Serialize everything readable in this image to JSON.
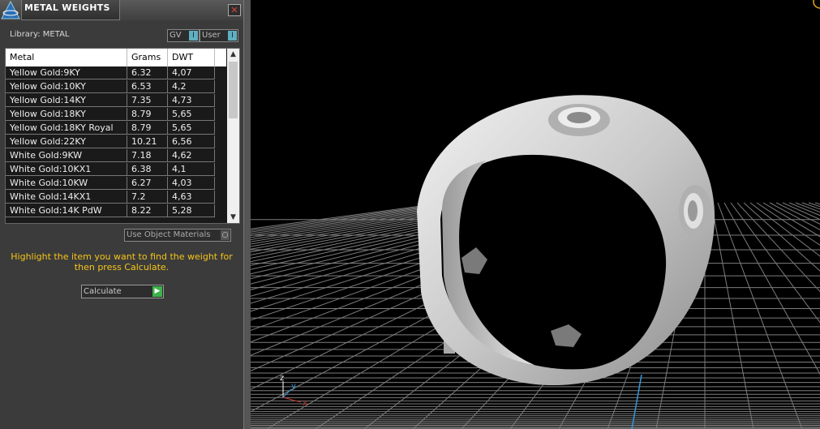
{
  "panel": {
    "title": "METAL WEIGHTS",
    "close_glyph": "✕",
    "library_label": "Library: METAL",
    "gv_label": "GV",
    "user_label": "User",
    "toggle_glyph": "I",
    "columns": [
      "Metal",
      "Grams",
      "DWT"
    ],
    "rows": [
      {
        "metal": "Yellow Gold:9KY",
        "grams": "6.32",
        "dwt": "4,07"
      },
      {
        "metal": "Yellow Gold:10KY",
        "grams": "6.53",
        "dwt": "4,2"
      },
      {
        "metal": "Yellow Gold:14KY",
        "grams": "7.35",
        "dwt": "4,73"
      },
      {
        "metal": "Yellow Gold:18KY",
        "grams": "8.79",
        "dwt": "5,65"
      },
      {
        "metal": "Yellow Gold:18KY Royal",
        "grams": "8.79",
        "dwt": "5,65"
      },
      {
        "metal": "Yellow Gold:22KY",
        "grams": "10.21",
        "dwt": "6,56"
      },
      {
        "metal": "White Gold:9KW",
        "grams": "7.18",
        "dwt": "4,62"
      },
      {
        "metal": "White Gold:10KX1",
        "grams": "6.38",
        "dwt": "4,1"
      },
      {
        "metal": "White Gold:10KW",
        "grams": "6.27",
        "dwt": "4,03"
      },
      {
        "metal": "White Gold:14KX1",
        "grams": "7.2",
        "dwt": "4,63"
      },
      {
        "metal": "White Gold:14K PdW",
        "grams": "8.22",
        "dwt": "5,28"
      }
    ],
    "use_object_materials": "Use Object Materials",
    "hint": "Highlight the item you want to find the weight for then press Calculate.",
    "calculate_label": "Calculate"
  },
  "viewport": {
    "axis_labels": {
      "z": "z",
      "y": "y",
      "x": "x"
    },
    "colors": {
      "background": "#000000",
      "grid": "#8a8a8a",
      "ring": "#cfcfcf",
      "x_axis": "#c0392b",
      "y_axis": "#3498db",
      "z_axis": "#ffffff"
    }
  }
}
